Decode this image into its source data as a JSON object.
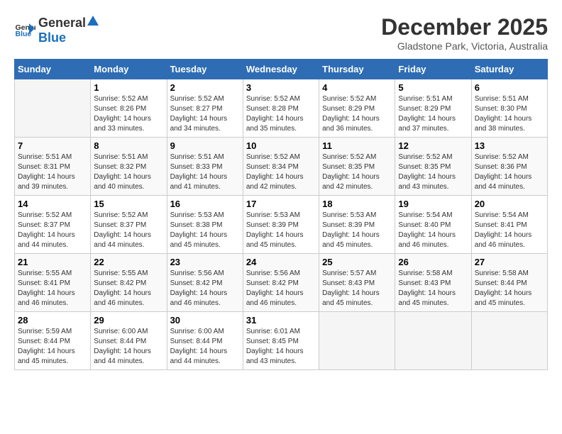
{
  "logo": {
    "general": "General",
    "blue": "Blue"
  },
  "title": "December 2025",
  "subtitle": "Gladstone Park, Victoria, Australia",
  "days_header": [
    "Sunday",
    "Monday",
    "Tuesday",
    "Wednesday",
    "Thursday",
    "Friday",
    "Saturday"
  ],
  "weeks": [
    [
      {
        "day": "",
        "sunrise": "",
        "sunset": "",
        "daylight": ""
      },
      {
        "day": "1",
        "sunrise": "Sunrise: 5:52 AM",
        "sunset": "Sunset: 8:26 PM",
        "daylight": "Daylight: 14 hours and 33 minutes."
      },
      {
        "day": "2",
        "sunrise": "Sunrise: 5:52 AM",
        "sunset": "Sunset: 8:27 PM",
        "daylight": "Daylight: 14 hours and 34 minutes."
      },
      {
        "day": "3",
        "sunrise": "Sunrise: 5:52 AM",
        "sunset": "Sunset: 8:28 PM",
        "daylight": "Daylight: 14 hours and 35 minutes."
      },
      {
        "day": "4",
        "sunrise": "Sunrise: 5:52 AM",
        "sunset": "Sunset: 8:29 PM",
        "daylight": "Daylight: 14 hours and 36 minutes."
      },
      {
        "day": "5",
        "sunrise": "Sunrise: 5:51 AM",
        "sunset": "Sunset: 8:29 PM",
        "daylight": "Daylight: 14 hours and 37 minutes."
      },
      {
        "day": "6",
        "sunrise": "Sunrise: 5:51 AM",
        "sunset": "Sunset: 8:30 PM",
        "daylight": "Daylight: 14 hours and 38 minutes."
      }
    ],
    [
      {
        "day": "7",
        "sunrise": "Sunrise: 5:51 AM",
        "sunset": "Sunset: 8:31 PM",
        "daylight": "Daylight: 14 hours and 39 minutes."
      },
      {
        "day": "8",
        "sunrise": "Sunrise: 5:51 AM",
        "sunset": "Sunset: 8:32 PM",
        "daylight": "Daylight: 14 hours and 40 minutes."
      },
      {
        "day": "9",
        "sunrise": "Sunrise: 5:51 AM",
        "sunset": "Sunset: 8:33 PM",
        "daylight": "Daylight: 14 hours and 41 minutes."
      },
      {
        "day": "10",
        "sunrise": "Sunrise: 5:52 AM",
        "sunset": "Sunset: 8:34 PM",
        "daylight": "Daylight: 14 hours and 42 minutes."
      },
      {
        "day": "11",
        "sunrise": "Sunrise: 5:52 AM",
        "sunset": "Sunset: 8:35 PM",
        "daylight": "Daylight: 14 hours and 42 minutes."
      },
      {
        "day": "12",
        "sunrise": "Sunrise: 5:52 AM",
        "sunset": "Sunset: 8:35 PM",
        "daylight": "Daylight: 14 hours and 43 minutes."
      },
      {
        "day": "13",
        "sunrise": "Sunrise: 5:52 AM",
        "sunset": "Sunset: 8:36 PM",
        "daylight": "Daylight: 14 hours and 44 minutes."
      }
    ],
    [
      {
        "day": "14",
        "sunrise": "Sunrise: 5:52 AM",
        "sunset": "Sunset: 8:37 PM",
        "daylight": "Daylight: 14 hours and 44 minutes."
      },
      {
        "day": "15",
        "sunrise": "Sunrise: 5:52 AM",
        "sunset": "Sunset: 8:37 PM",
        "daylight": "Daylight: 14 hours and 44 minutes."
      },
      {
        "day": "16",
        "sunrise": "Sunrise: 5:53 AM",
        "sunset": "Sunset: 8:38 PM",
        "daylight": "Daylight: 14 hours and 45 minutes."
      },
      {
        "day": "17",
        "sunrise": "Sunrise: 5:53 AM",
        "sunset": "Sunset: 8:39 PM",
        "daylight": "Daylight: 14 hours and 45 minutes."
      },
      {
        "day": "18",
        "sunrise": "Sunrise: 5:53 AM",
        "sunset": "Sunset: 8:39 PM",
        "daylight": "Daylight: 14 hours and 45 minutes."
      },
      {
        "day": "19",
        "sunrise": "Sunrise: 5:54 AM",
        "sunset": "Sunset: 8:40 PM",
        "daylight": "Daylight: 14 hours and 46 minutes."
      },
      {
        "day": "20",
        "sunrise": "Sunrise: 5:54 AM",
        "sunset": "Sunset: 8:41 PM",
        "daylight": "Daylight: 14 hours and 46 minutes."
      }
    ],
    [
      {
        "day": "21",
        "sunrise": "Sunrise: 5:55 AM",
        "sunset": "Sunset: 8:41 PM",
        "daylight": "Daylight: 14 hours and 46 minutes."
      },
      {
        "day": "22",
        "sunrise": "Sunrise: 5:55 AM",
        "sunset": "Sunset: 8:42 PM",
        "daylight": "Daylight: 14 hours and 46 minutes."
      },
      {
        "day": "23",
        "sunrise": "Sunrise: 5:56 AM",
        "sunset": "Sunset: 8:42 PM",
        "daylight": "Daylight: 14 hours and 46 minutes."
      },
      {
        "day": "24",
        "sunrise": "Sunrise: 5:56 AM",
        "sunset": "Sunset: 8:42 PM",
        "daylight": "Daylight: 14 hours and 46 minutes."
      },
      {
        "day": "25",
        "sunrise": "Sunrise: 5:57 AM",
        "sunset": "Sunset: 8:43 PM",
        "daylight": "Daylight: 14 hours and 45 minutes."
      },
      {
        "day": "26",
        "sunrise": "Sunrise: 5:58 AM",
        "sunset": "Sunset: 8:43 PM",
        "daylight": "Daylight: 14 hours and 45 minutes."
      },
      {
        "day": "27",
        "sunrise": "Sunrise: 5:58 AM",
        "sunset": "Sunset: 8:44 PM",
        "daylight": "Daylight: 14 hours and 45 minutes."
      }
    ],
    [
      {
        "day": "28",
        "sunrise": "Sunrise: 5:59 AM",
        "sunset": "Sunset: 8:44 PM",
        "daylight": "Daylight: 14 hours and 45 minutes."
      },
      {
        "day": "29",
        "sunrise": "Sunrise: 6:00 AM",
        "sunset": "Sunset: 8:44 PM",
        "daylight": "Daylight: 14 hours and 44 minutes."
      },
      {
        "day": "30",
        "sunrise": "Sunrise: 6:00 AM",
        "sunset": "Sunset: 8:44 PM",
        "daylight": "Daylight: 14 hours and 44 minutes."
      },
      {
        "day": "31",
        "sunrise": "Sunrise: 6:01 AM",
        "sunset": "Sunset: 8:45 PM",
        "daylight": "Daylight: 14 hours and 43 minutes."
      },
      {
        "day": "",
        "sunrise": "",
        "sunset": "",
        "daylight": ""
      },
      {
        "day": "",
        "sunrise": "",
        "sunset": "",
        "daylight": ""
      },
      {
        "day": "",
        "sunrise": "",
        "sunset": "",
        "daylight": ""
      }
    ]
  ]
}
